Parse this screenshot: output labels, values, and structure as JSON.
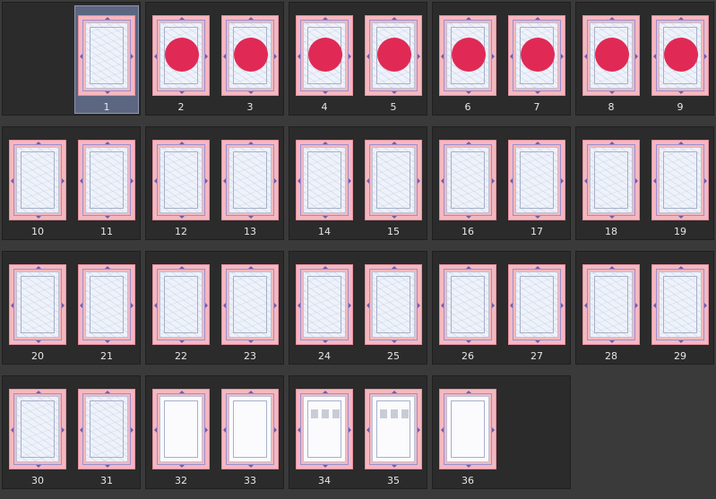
{
  "colors": {
    "background": "#3a3a3a",
    "spread_panel": "#2b2b2b",
    "selection": "#5c6680",
    "page_margin_pink": "#f4b8c0",
    "marker_red": "#e02a55"
  },
  "selected_page": "1",
  "spreads": [
    {
      "pages": [
        null,
        {
          "number": "1",
          "thumb": "sketch-light",
          "marker": false
        }
      ]
    },
    {
      "pages": [
        {
          "number": "2",
          "thumb": "sketch",
          "marker": true
        },
        {
          "number": "3",
          "thumb": "sketch",
          "marker": true
        }
      ]
    },
    {
      "pages": [
        {
          "number": "4",
          "thumb": "sketch",
          "marker": true
        },
        {
          "number": "5",
          "thumb": "sketch",
          "marker": true
        }
      ]
    },
    {
      "pages": [
        {
          "number": "6",
          "thumb": "sketch",
          "marker": true
        },
        {
          "number": "7",
          "thumb": "sketch",
          "marker": true
        }
      ]
    },
    {
      "pages": [
        {
          "number": "8",
          "thumb": "sketch",
          "marker": true
        },
        {
          "number": "9",
          "thumb": "sketch",
          "marker": true
        }
      ]
    },
    {
      "pages": [
        {
          "number": "10",
          "thumb": "sketch"
        },
        {
          "number": "11",
          "thumb": "sketch"
        }
      ]
    },
    {
      "pages": [
        {
          "number": "12",
          "thumb": "sketch"
        },
        {
          "number": "13",
          "thumb": "sketch"
        }
      ]
    },
    {
      "pages": [
        {
          "number": "14",
          "thumb": "sketch"
        },
        {
          "number": "15",
          "thumb": "sketch"
        }
      ]
    },
    {
      "pages": [
        {
          "number": "16",
          "thumb": "sketch"
        },
        {
          "number": "17",
          "thumb": "sketch"
        }
      ]
    },
    {
      "pages": [
        {
          "number": "18",
          "thumb": "sketch"
        },
        {
          "number": "19",
          "thumb": "sketch"
        }
      ]
    },
    {
      "pages": [
        {
          "number": "20",
          "thumb": "sketch"
        },
        {
          "number": "21",
          "thumb": "sketch"
        }
      ]
    },
    {
      "pages": [
        {
          "number": "22",
          "thumb": "sketch"
        },
        {
          "number": "23",
          "thumb": "sketch"
        }
      ]
    },
    {
      "pages": [
        {
          "number": "24",
          "thumb": "sketch"
        },
        {
          "number": "25",
          "thumb": "sketch"
        }
      ]
    },
    {
      "pages": [
        {
          "number": "26",
          "thumb": "sketch"
        },
        {
          "number": "27",
          "thumb": "sketch"
        }
      ]
    },
    {
      "pages": [
        {
          "number": "28",
          "thumb": "sketch"
        },
        {
          "number": "29",
          "thumb": "sketch"
        }
      ]
    },
    {
      "pages": [
        {
          "number": "30",
          "thumb": "sketch"
        },
        {
          "number": "31",
          "thumb": "sketch"
        }
      ]
    },
    {
      "pages": [
        {
          "number": "32",
          "thumb": "blank"
        },
        {
          "number": "33",
          "thumb": "blank"
        }
      ]
    },
    {
      "pages": [
        {
          "number": "34",
          "thumb": "panels"
        },
        {
          "number": "35",
          "thumb": "panels"
        }
      ]
    },
    {
      "pages": [
        {
          "number": "36",
          "thumb": "blank"
        },
        null
      ]
    }
  ]
}
